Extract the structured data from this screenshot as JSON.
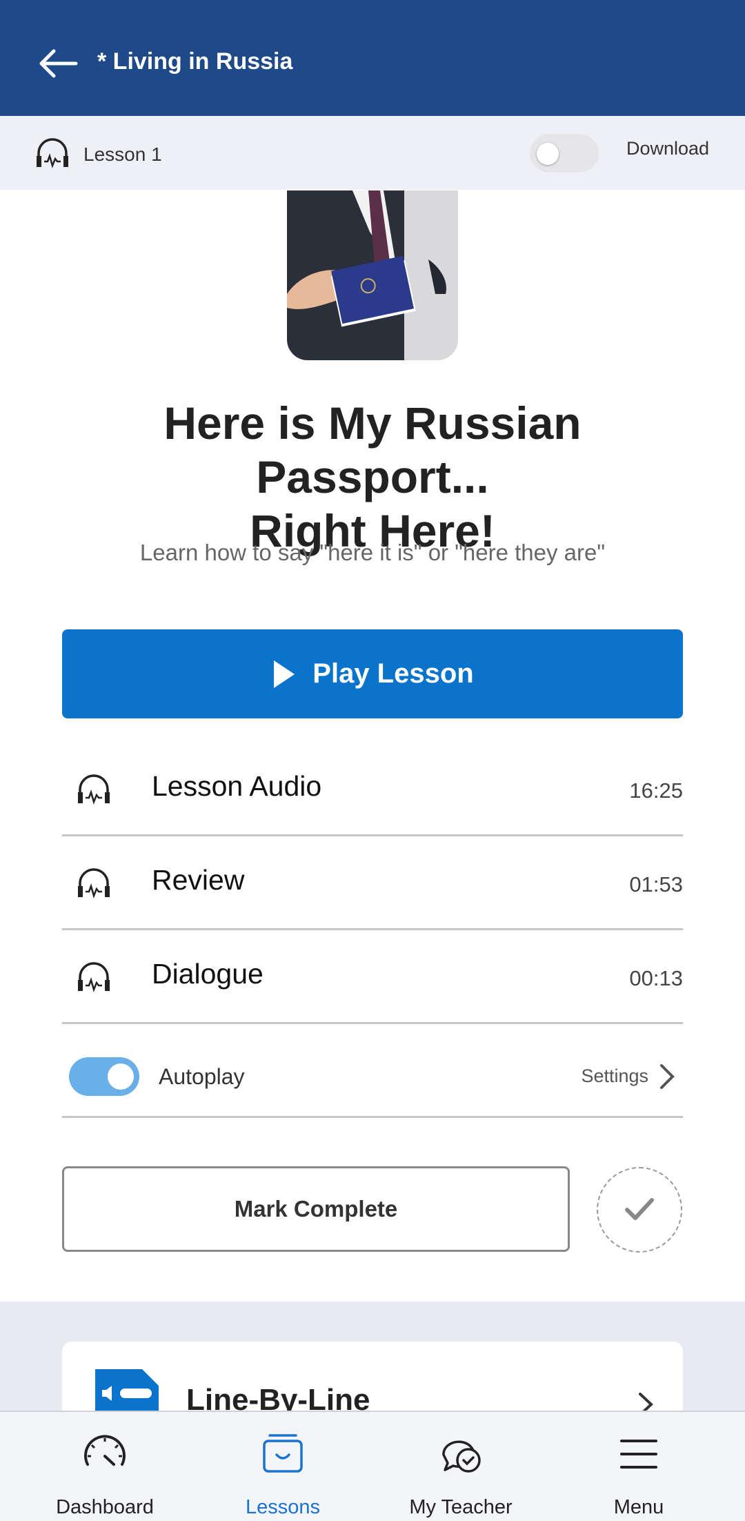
{
  "header": {
    "title": "* Living in Russia"
  },
  "lesson_bar": {
    "label": "Lesson 1",
    "download_label": "Download",
    "download_on": false
  },
  "lesson": {
    "title_line1": "Here is My Russian Passport...",
    "title_line2": "Right Here!",
    "subtitle": "Learn how to say \"here it is\" or \"here they are\"",
    "play_label": "Play Lesson"
  },
  "tracks": [
    {
      "label": "Lesson Audio",
      "time": "16:25"
    },
    {
      "label": "Review",
      "time": "01:53"
    },
    {
      "label": "Dialogue",
      "time": "00:13"
    }
  ],
  "autoplay": {
    "label": "Autoplay",
    "on": true,
    "settings_label": "Settings"
  },
  "mark_complete": {
    "label": "Mark Complete"
  },
  "card": {
    "title": "Line-By-Line"
  },
  "nav": {
    "items": [
      {
        "label": "Dashboard",
        "icon": "speedometer-icon"
      },
      {
        "label": "Lessons",
        "icon": "inbox-icon",
        "active": true
      },
      {
        "label": "My Teacher",
        "icon": "chat-icon"
      },
      {
        "label": "Menu",
        "icon": "hamburger-icon"
      }
    ]
  },
  "colors": {
    "header_bg": "#1e4a8a",
    "accent": "#0a73cc",
    "active_nav": "#1a73d0",
    "toggle_on": "#6ab0e8"
  }
}
